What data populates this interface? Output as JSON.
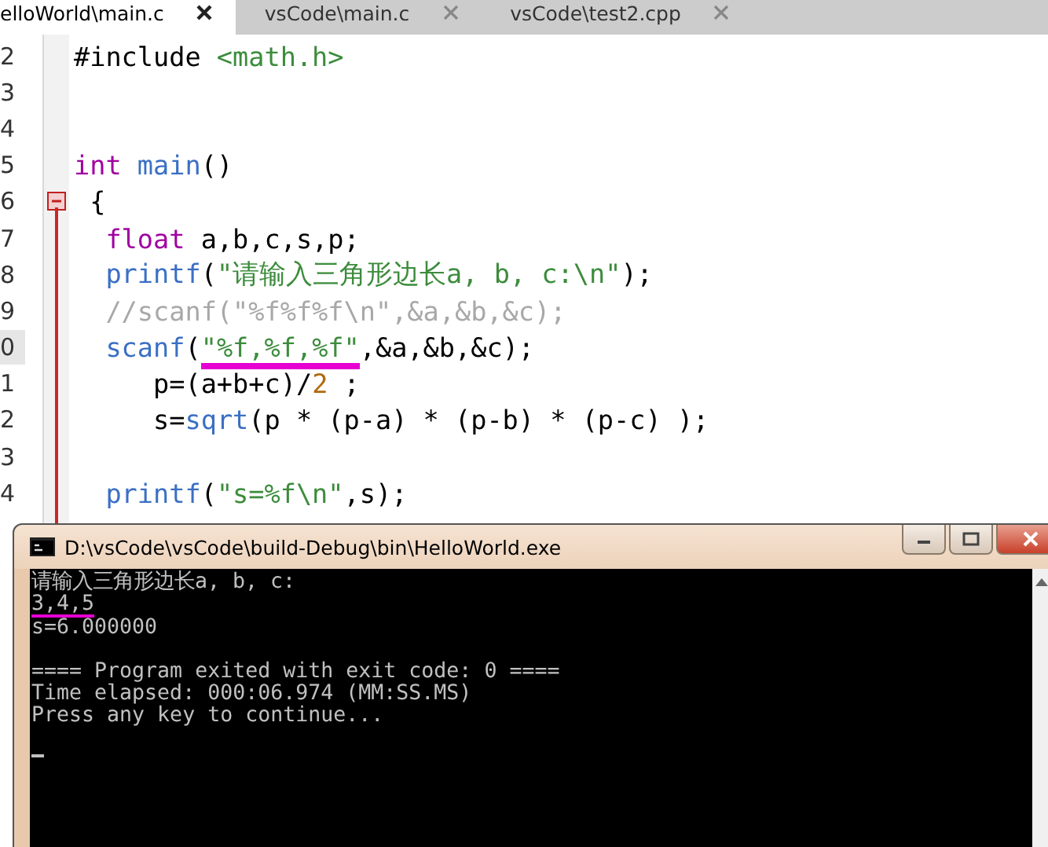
{
  "tabs": [
    {
      "label": "elloWorld\\main.c",
      "selected": true
    },
    {
      "label": "vsCode\\main.c",
      "selected": false
    },
    {
      "label": "vsCode\\test2.cpp",
      "selected": false
    }
  ],
  "editor": {
    "lines": [
      {
        "number": "2",
        "current": false,
        "fold": false,
        "tokens": [
          {
            "kind": "plain",
            "text": "#include"
          },
          {
            "kind": "string",
            "text": " <math.h>"
          }
        ]
      },
      {
        "number": "3",
        "current": false,
        "fold": false
      },
      {
        "number": "4",
        "current": false,
        "fold": false
      },
      {
        "number": "5",
        "current": false,
        "fold": false,
        "tokens": [
          {
            "kind": "keyword",
            "text": "int"
          },
          {
            "kind": "function",
            "text": " main"
          },
          {
            "kind": "plain",
            "text": "()"
          }
        ]
      },
      {
        "number": "6",
        "current": false,
        "fold": true,
        "tokens": [
          {
            "kind": "plain",
            "text": " {"
          }
        ]
      },
      {
        "number": "7",
        "current": false,
        "fold": false,
        "tokens": [
          {
            "kind": "keyword",
            "text": "  float"
          },
          {
            "kind": "plain",
            "text": " a,b,c,s,p;"
          }
        ]
      },
      {
        "number": "8",
        "current": false,
        "fold": false,
        "tokens": [
          {
            "kind": "function",
            "text": "  printf"
          },
          {
            "kind": "plain",
            "text": "("
          },
          {
            "kind": "string",
            "text": "\"请输入三角形边长a, b, c:\\n\""
          },
          {
            "kind": "plain",
            "text": ");"
          }
        ]
      },
      {
        "number": "9",
        "current": false,
        "fold": false,
        "tokens": [
          {
            "kind": "comment",
            "text": "  //scanf(\"%f%f%f\\n\",&a,&b,&c);"
          }
        ]
      },
      {
        "number": "0",
        "current": true,
        "fold": false,
        "tokens": [
          {
            "kind": "function",
            "text": "  scanf",
            "marked": false
          },
          {
            "kind": "plain",
            "text": "(",
            "marked": false
          },
          {
            "kind": "string",
            "text": "\"%f,%f,%f\"",
            "marked": true
          },
          {
            "kind": "plain",
            "text": ",&a,&b,&c);",
            "marked": false
          }
        ]
      },
      {
        "number": "1",
        "current": false,
        "fold": false,
        "tokens": [
          {
            "kind": "plain",
            "text": "     p=(a+b+c)/"
          },
          {
            "kind": "number",
            "text": "2"
          },
          {
            "kind": "plain",
            "text": " ;"
          }
        ]
      },
      {
        "number": "2",
        "current": false,
        "fold": false,
        "tokens": [
          {
            "kind": "plain",
            "text": "     s="
          },
          {
            "kind": "function",
            "text": "sqrt"
          },
          {
            "kind": "plain",
            "text": "(p * (p-a) * (p-b) * (p-c) );"
          }
        ]
      },
      {
        "number": "3",
        "current": false,
        "fold": false
      },
      {
        "number": "4",
        "current": false,
        "fold": false,
        "tokens": [
          {
            "kind": "function",
            "text": "  printf"
          },
          {
            "kind": "plain",
            "text": "("
          },
          {
            "kind": "string",
            "text": "\"s=%f\\n\""
          },
          {
            "kind": "plain",
            "text": ",s);"
          }
        ]
      }
    ]
  },
  "console": {
    "title": "D:\\vsCode\\vsCode\\build-Debug\\bin\\HelloWorld.exe",
    "lines": [
      {
        "text": "请输入三角形边长a, b, c:",
        "marked": false,
        "blank_before": false
      },
      {
        "text": "3,4,5",
        "marked": true,
        "blank_before": false
      },
      {
        "text": "s=6.000000",
        "marked": false,
        "blank_before": false
      },
      {
        "text": "==== Program exited with exit code: 0 ====",
        "marked": false,
        "blank_before": true
      },
      {
        "text": "Time elapsed: 000:06.974 (MM:SS.MS)",
        "marked": false,
        "blank_before": false
      },
      {
        "text": "Press any key to continue...",
        "marked": false,
        "blank_before": false
      }
    ]
  }
}
